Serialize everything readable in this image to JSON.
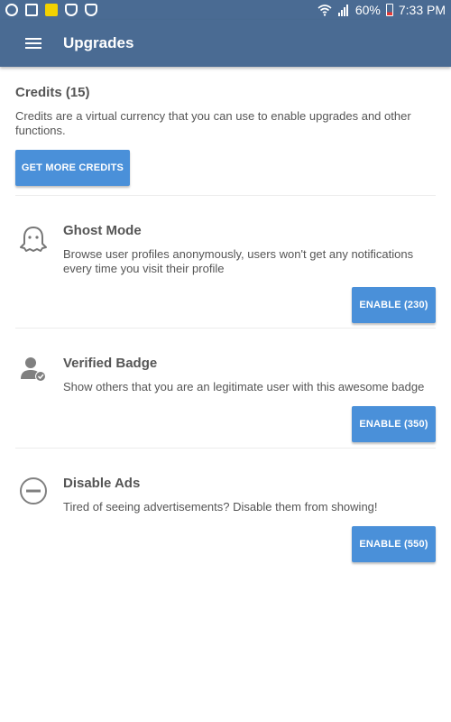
{
  "status_bar": {
    "battery": "60%",
    "time": "7:33 PM",
    "icons": [
      "whatsapp-icon",
      "image-icon",
      "app-icon",
      "shield-icon",
      "shield-icon",
      "wifi-icon",
      "signal-icon",
      "battery-icon"
    ]
  },
  "app_bar": {
    "title": "Upgrades",
    "menu_icon": "hamburger-menu-icon",
    "background": "#4a6b93"
  },
  "credits": {
    "title": "Credits (15)",
    "description": "Credits are a virtual currency that you can use to enable upgrades and other functions.",
    "button_label": "GET MORE CREDITS"
  },
  "upgrades": [
    {
      "icon": "ghost-icon",
      "title": "Ghost Mode",
      "description": "Browse user profiles anonymously, users won't get any notifications every time you visit their profile",
      "button_label": "ENABLE (230)"
    },
    {
      "icon": "verified-user-icon",
      "title": "Verified Badge",
      "description": "Show others that you are an legitimate user with this awesome badge",
      "button_label": "ENABLE (350)"
    },
    {
      "icon": "block-icon",
      "title": "Disable Ads",
      "description": "Tired of seeing advertisements? Disable them from showing!",
      "button_label": "ENABLE (550)"
    }
  ],
  "colors": {
    "primary": "#4a6b93",
    "button": "#4a90d9",
    "text": "#555555"
  }
}
